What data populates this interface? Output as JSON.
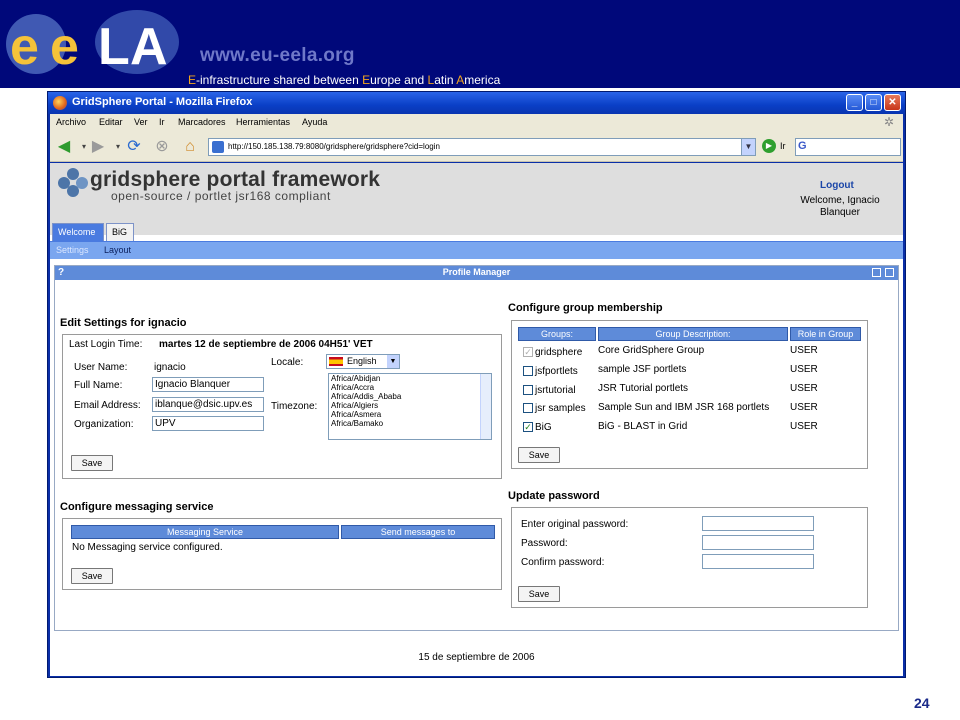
{
  "slide": {
    "site_url": "www.eu-eela.org",
    "tagline": {
      "e1": "E",
      "t1": "-infrastructure shared between ",
      "e2": "E",
      "t2": "urope and ",
      "e3": "L",
      "t3": "atin ",
      "e4": "A",
      "t4": "merica"
    },
    "page_number": "24",
    "logo_text": "eeLA"
  },
  "browser": {
    "title": "GridSphere Portal - Mozilla Firefox",
    "menu": [
      "Archivo",
      "Editar",
      "Ver",
      "Ir",
      "Marcadores",
      "Herramientas",
      "Ayuda"
    ],
    "url": "http://150.185.138.79:8080/gridsphere/gridsphere?cid=login",
    "go_label": "Ir",
    "search_engine": "G"
  },
  "portal": {
    "title": "gridsphere portal framework",
    "subtitle": "open-source / portlet jsr168 compliant",
    "logout": "Logout",
    "welcome_line1": "Welcome, Ignacio",
    "welcome_line2": "Blanquer",
    "tabs": [
      "Welcome",
      "BiG"
    ],
    "subtabs": [
      "Settings",
      "Layout"
    ],
    "footer_date": "15 de septiembre de 2006"
  },
  "profile_manager": {
    "help": "?",
    "title": "Profile Manager",
    "edit_settings": {
      "heading": "Edit Settings for  ignacio",
      "last_login_label": "Last Login Time:",
      "last_login_value": "martes 12 de septiembre de 2006 04H51' VET",
      "user_name_label": "User Name:",
      "user_name_value": "ignacio",
      "full_name_label": "Full Name:",
      "full_name_value": "Ignacio Blanquer",
      "email_label": "Email Address:",
      "email_value": "iblanque@dsic.upv.es",
      "organization_label": "Organization:",
      "organization_value": "UPV",
      "locale_label": "Locale:",
      "locale_value": "English",
      "timezone_label": "Timezone:",
      "timezones": [
        "Africa/Abidjan",
        "Africa/Accra",
        "Africa/Addis_Ababa",
        "Africa/Algiers",
        "Africa/Asmera",
        "Africa/Bamako"
      ],
      "save": "Save"
    },
    "messaging": {
      "heading": "Configure messaging service",
      "col_service": "Messaging Service",
      "col_send": "Send messages to",
      "empty": "No Messaging service configured.",
      "save": "Save"
    },
    "groups": {
      "heading": "Configure group membership",
      "col_groups": "Groups:",
      "col_desc": "Group Description:",
      "col_role": "Role in Group",
      "rows": [
        {
          "name": "gridsphere",
          "description": "Core GridSphere Group",
          "role": "USER",
          "checked": true,
          "disabled": true
        },
        {
          "name": "jsfportlets",
          "description": "sample JSF portlets",
          "role": "USER",
          "checked": false,
          "disabled": false
        },
        {
          "name": "jsrtutorial",
          "description": "JSR Tutorial portlets",
          "role": "USER",
          "checked": false,
          "disabled": false
        },
        {
          "name": "jsr samples",
          "description": "Sample Sun and IBM JSR 168 portlets",
          "role": "USER",
          "checked": false,
          "disabled": false
        },
        {
          "name": "BiG",
          "description": "BiG - BLAST in Grid",
          "role": "USER",
          "checked": true,
          "disabled": false
        }
      ],
      "save": "Save"
    },
    "password": {
      "heading": "Update password",
      "original_label": "Enter original password:",
      "password_label": "Password:",
      "confirm_label": "Confirm password:",
      "save": "Save"
    }
  }
}
